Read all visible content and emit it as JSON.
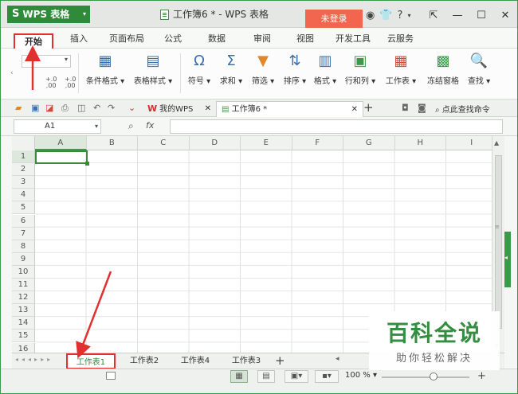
{
  "titlebar": {
    "app_name": "WPS 表格",
    "doc_title": "工作簿6 * - WPS 表格",
    "login_label": "未登录",
    "help_label": "?"
  },
  "menu": {
    "tabs": [
      "开始",
      "插入",
      "页面布局",
      "公式",
      "数据",
      "审阅",
      "视图",
      "开发工具",
      "云服务"
    ]
  },
  "ribbon": {
    "buttons": [
      {
        "label": "条件格式 ▾",
        "icon": "conditional-format-icon"
      },
      {
        "label": "表格样式 ▾",
        "icon": "table-style-icon"
      },
      {
        "label": "符号 ▾",
        "icon": "omega-symbol-icon",
        "glyph": "Ω"
      },
      {
        "label": "求和 ▾",
        "icon": "sum-icon",
        "glyph": "Σ"
      },
      {
        "label": "筛选 ▾",
        "icon": "filter-icon"
      },
      {
        "label": "排序 ▾",
        "icon": "sort-icon"
      },
      {
        "label": "格式 ▾",
        "icon": "format-icon"
      },
      {
        "label": "行和列 ▾",
        "icon": "rows-cols-icon"
      },
      {
        "label": "工作表 ▾",
        "icon": "worksheet-icon"
      },
      {
        "label": "冻结窗格",
        "icon": "freeze-panes-icon"
      },
      {
        "label": "查找 ▾",
        "icon": "find-icon"
      }
    ],
    "numfmt_increase": "+.0\n.00",
    "numfmt_decrease": "+.0\n.00"
  },
  "doctabs": {
    "mywps": "我的WPS",
    "sheet": "工作簿6 *",
    "find_command": "点此查找命令"
  },
  "formula": {
    "cell_ref": "A1",
    "fx": "fx"
  },
  "grid": {
    "columns": [
      "A",
      "B",
      "C",
      "D",
      "E",
      "F",
      "G",
      "H",
      "I"
    ],
    "rows": [
      "1",
      "2",
      "3",
      "4",
      "5",
      "6",
      "7",
      "8",
      "9",
      "10",
      "11",
      "12",
      "13",
      "14",
      "15",
      "16"
    ],
    "active_cell": "A1"
  },
  "sheets": [
    "工作表1",
    "工作表2",
    "工作表4",
    "工作表3"
  ],
  "status": {
    "zoom": "100 % ▾"
  },
  "watermark": {
    "title": "百科全说",
    "subtitle": "助你轻松解决"
  },
  "colors": {
    "brand_green": "#2f8b3a",
    "login_red": "#f2654f",
    "annotation_red": "#e03030"
  }
}
